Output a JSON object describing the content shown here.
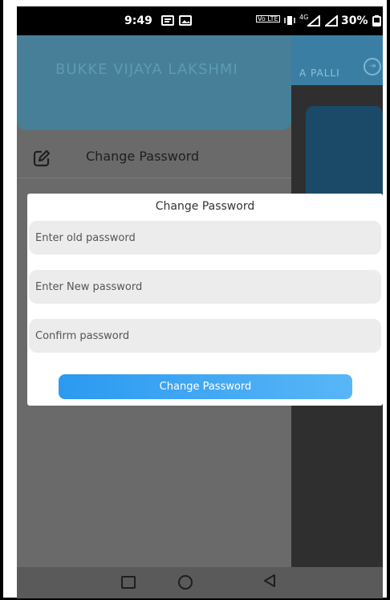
{
  "status_bar": {
    "time": "9:49",
    "network_label": "Vo LTE",
    "signal_label": "4G",
    "battery": "30%"
  },
  "background": {
    "location_text": "A PALLI"
  },
  "drawer": {
    "user_name": "BUKKE VIJAYA LAKSHMI",
    "items": [
      {
        "label": "Change Password",
        "icon": "edit-icon"
      }
    ]
  },
  "dialog": {
    "title": "Change Password",
    "fields": [
      {
        "placeholder": "Enter old password",
        "value": ""
      },
      {
        "placeholder": "Enter New password",
        "value": ""
      },
      {
        "placeholder": "Confirm password",
        "value": ""
      }
    ],
    "submit_label": "Change Password"
  },
  "colors": {
    "drawer_header": "#467f97",
    "button_start": "#2b9af0",
    "button_end": "#59b6f7"
  }
}
